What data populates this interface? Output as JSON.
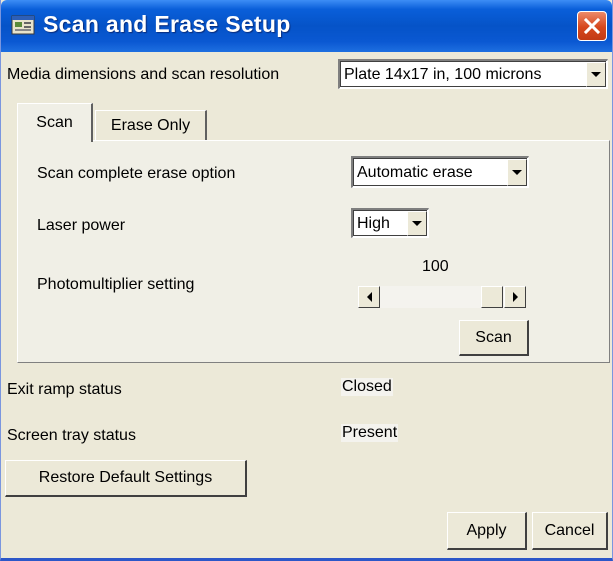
{
  "window": {
    "title": "Scan and Erase Setup",
    "close_symbol": "✕"
  },
  "media": {
    "label": "Media dimensions and scan resolution",
    "selected": "Plate 14x17 in, 100 microns"
  },
  "tabs": [
    {
      "label": "Scan",
      "active": true
    },
    {
      "label": "Erase Only",
      "active": false
    }
  ],
  "scan_tab": {
    "erase_option_label": "Scan complete erase option",
    "erase_option_value": "Automatic erase",
    "laser_power_label": "Laser power",
    "laser_power_value": "High",
    "photomultiplier_label": "Photomultiplier setting",
    "photomultiplier_value": "100",
    "scan_button": "Scan"
  },
  "status": {
    "exit_ramp_label": "Exit ramp status",
    "exit_ramp_value": "Closed",
    "screen_tray_label": "Screen tray status",
    "screen_tray_value": "Present"
  },
  "buttons": {
    "restore": "Restore Default Settings",
    "apply": "Apply",
    "cancel": "Cancel"
  },
  "icons": {
    "title": "dialog-app-icon",
    "close": "close-icon",
    "dropdown": "chevron-down-icon",
    "scroll_left": "arrow-left-icon",
    "scroll_right": "arrow-right-icon"
  },
  "colors": {
    "titlebar": "#0553c8",
    "close_button": "#d6471d",
    "window_bg": "#ece9d8"
  }
}
